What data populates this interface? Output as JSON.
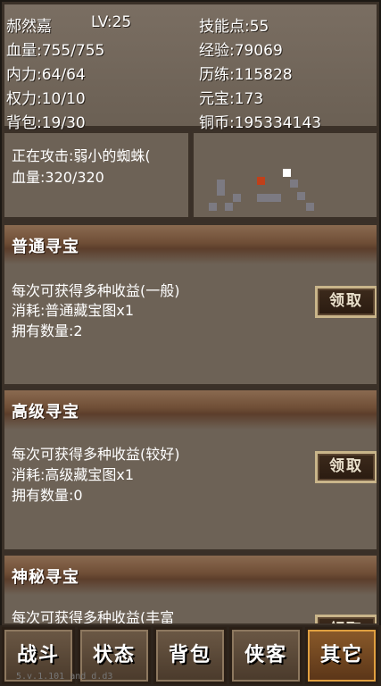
{
  "stats": {
    "name": "郝然嘉",
    "level": "LV:25",
    "hp": "血量:755/755",
    "mp": "内力:64/64",
    "power": "权力:10/10",
    "bag": "背包:19/30",
    "skill_points": "技能点:55",
    "exp": "经验:79069",
    "experience": "历练:115828",
    "gold": "元宝:173",
    "copper": "铜币:195334143"
  },
  "combat": {
    "attacking": "正在攻击:弱小的蜘蛛(",
    "enemy_hp": "血量:320/320"
  },
  "sections": [
    {
      "title": "普通寻宝",
      "desc": "每次可获得多种收益(一般)",
      "cost": "消耗:普通藏宝图x1",
      "owned": "拥有数量:2",
      "button": "领取"
    },
    {
      "title": "高级寻宝",
      "desc": "每次可获得多种收益(较好)",
      "cost": "消耗:高级藏宝图x1",
      "owned": "拥有数量:0",
      "button": "领取"
    },
    {
      "title": "神秘寻宝",
      "desc": "每次可获得多种收益(丰富",
      "button": "领取"
    }
  ],
  "nav": [
    "战斗",
    "状态",
    "背包",
    "侠客",
    "其它"
  ],
  "version": "5.v.1.101_and_d.d3",
  "colors": {
    "player_marker": "#ffffff",
    "enemy_marker": "#c0401a",
    "active_tab": "#8a5a2a"
  }
}
